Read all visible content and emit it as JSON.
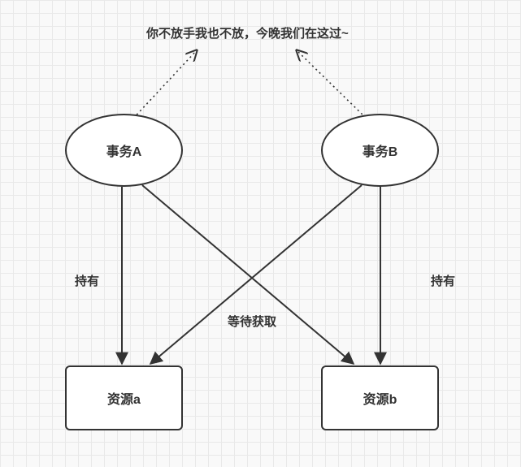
{
  "caption": "你不放手我也不放，今晚我们在这过~",
  "nodes": {
    "transactionA": "事务A",
    "transactionB": "事务B",
    "resourceA": "资源a",
    "resourceB": "资源b"
  },
  "edges": {
    "holdsLeft": "持有",
    "holdsRight": "持有",
    "waitingFor": "等待获取"
  }
}
